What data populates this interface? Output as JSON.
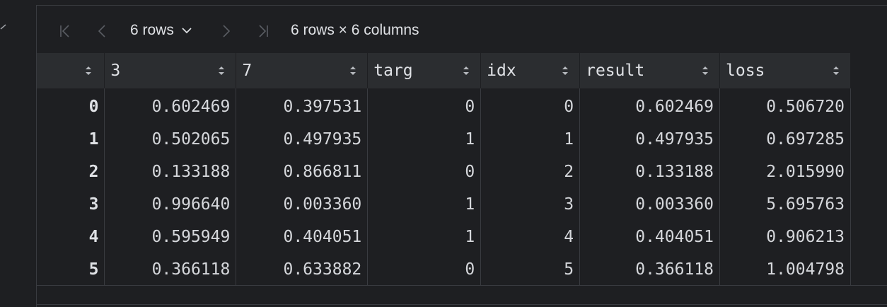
{
  "toolbar": {
    "rows_selector": "6 rows",
    "shape_text": "6 rows × 6 columns"
  },
  "table": {
    "columns": [
      "",
      "3",
      "7",
      "targ",
      "idx",
      "result",
      "loss"
    ],
    "rows": [
      [
        "0",
        "0.602469",
        "0.397531",
        "0",
        "0",
        "0.602469",
        "0.506720"
      ],
      [
        "1",
        "0.502065",
        "0.497935",
        "1",
        "1",
        "0.497935",
        "0.697285"
      ],
      [
        "2",
        "0.133188",
        "0.866811",
        "0",
        "2",
        "0.133188",
        "2.015990"
      ],
      [
        "3",
        "0.996640",
        "0.003360",
        "1",
        "3",
        "0.003360",
        "5.695763"
      ],
      [
        "4",
        "0.595949",
        "0.404051",
        "1",
        "4",
        "0.404051",
        "0.906213"
      ],
      [
        "5",
        "0.366118",
        "0.633882",
        "0",
        "5",
        "0.366118",
        "1.004798"
      ]
    ]
  },
  "icons": {
    "first": "first-page-icon",
    "prev": "previous-page-icon",
    "dropdown": "chevron-down-icon",
    "next": "next-page-icon",
    "last": "last-page-icon",
    "sort": "sort-icon"
  },
  "colors": {
    "background": "#1e1f22",
    "header_background": "#2b2d30",
    "text": "#d5d7db",
    "disabled_icon": "#5a5d63"
  }
}
